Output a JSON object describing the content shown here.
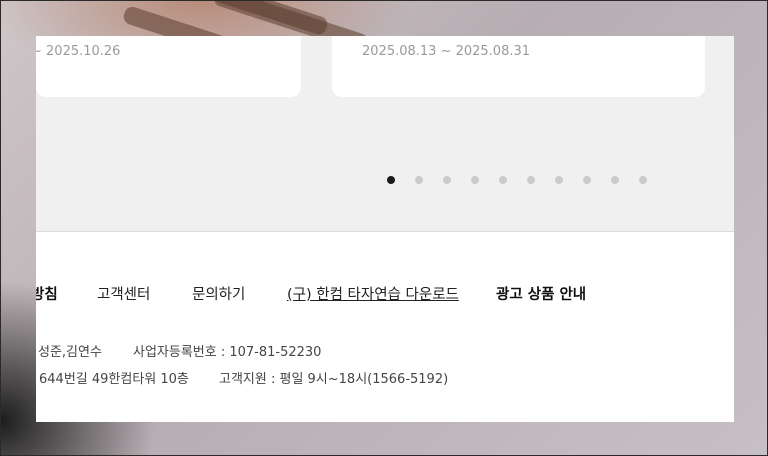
{
  "carousel": {
    "cards": [
      {
        "date": "~ 2025.10.26"
      },
      {
        "date": "2025.08.13 ~ 2025.08.31"
      }
    ],
    "page_count": 10,
    "active_index": 0
  },
  "footer": {
    "links": [
      {
        "label": "방침"
      },
      {
        "label": "고객센터"
      },
      {
        "label": "문의하기"
      },
      {
        "label": "(구) 한컴 타자연습 다운로드"
      },
      {
        "label": "광고 상품 안내"
      }
    ],
    "info": {
      "representatives": "성준,김연수",
      "business_reg": "사업자등록번호 : 107-81-52230",
      "address": "644번길 49한컴타워 10층",
      "support": "고객지원 : 평일 9시~18시(1566-5192)"
    }
  },
  "colors": {
    "panel_bg": "#f0f0f0",
    "dot_active": "#1a1a1a",
    "dot_inactive": "#cbcbcb"
  }
}
